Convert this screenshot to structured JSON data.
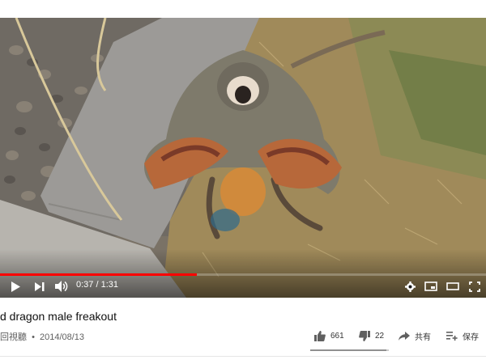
{
  "video": {
    "current_time": "0:37",
    "duration": "1:31",
    "progress_fraction": 0.405,
    "time_separator": " / "
  },
  "info": {
    "title": "d dragon male freakout",
    "views_text": "回視聽",
    "separator": "•",
    "date": "2014/08/13"
  },
  "actions": {
    "like_count": "661",
    "dislike_count": "22",
    "share_label": "共有",
    "save_label": "保存",
    "like_fraction": 0.968
  },
  "colors": {
    "accent": "#ff0000",
    "text_primary": "#0f0f0f",
    "text_secondary": "#606060"
  },
  "icons": {
    "play": "play-icon",
    "next": "next-icon",
    "volume": "volume-icon",
    "settings": "gear-icon",
    "miniplayer": "miniplayer-icon",
    "theater": "theater-icon",
    "fullscreen": "fullscreen-icon",
    "like": "thumbs-up-icon",
    "dislike": "thumbs-down-icon",
    "share": "share-icon",
    "save": "playlist-add-icon"
  }
}
